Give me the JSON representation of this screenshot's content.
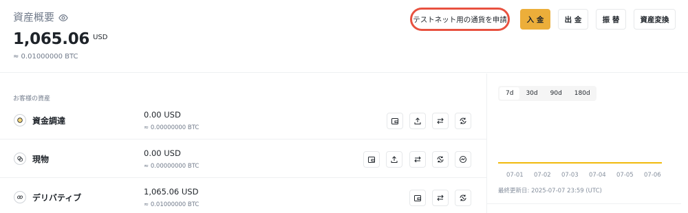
{
  "header": {
    "title": "資産概要",
    "total_value": "1,065.06",
    "total_unit": "USD",
    "btc_approx": "≈ 0.01000000 BTC"
  },
  "buttons": {
    "testnet": "テストネット用の通貨を申請",
    "deposit": "入 金",
    "withdraw": "出 金",
    "transfer": "振 替",
    "convert": "資産変換"
  },
  "colors": {
    "accent": "#F0B90B",
    "highlight_outline": "#E8513F"
  },
  "assets_section": {
    "label": "お客様の資産",
    "rows": [
      {
        "name": "資金調達",
        "usd": "0.00 USD",
        "btc": "≈ 0.00000000 BTC",
        "icon": "funding-icon",
        "actions": [
          "wallet-icon",
          "upload-icon",
          "transfer-icon",
          "convert-icon"
        ]
      },
      {
        "name": "現物",
        "usd": "0.00 USD",
        "btc": "≈ 0.00000000 BTC",
        "icon": "spot-icon",
        "actions": [
          "wallet-icon",
          "upload-icon",
          "transfer-icon",
          "convert-icon",
          "trade-icon"
        ]
      },
      {
        "name": "デリバティブ",
        "usd": "1,065.06 USD",
        "btc": "≈ 0.01000000 BTC",
        "icon": "derivatives-icon",
        "actions": [
          "wallet-icon",
          "transfer-icon",
          "convert-icon"
        ]
      }
    ]
  },
  "chart_panel": {
    "ranges": [
      "7d",
      "30d",
      "90d",
      "180d"
    ],
    "selected_range": "7d",
    "updated_text": "最終更新日: 2025-07-07 23:59 (UTC)"
  },
  "chart_data": {
    "type": "line",
    "x": [
      "07-01",
      "07-02",
      "07-03",
      "07-04",
      "07-05",
      "07-06"
    ],
    "series": [
      {
        "values": [
          1065.06,
          1065.06,
          1065.06,
          1065.06,
          1065.06,
          1065.06
        ]
      }
    ],
    "grid": false
  }
}
